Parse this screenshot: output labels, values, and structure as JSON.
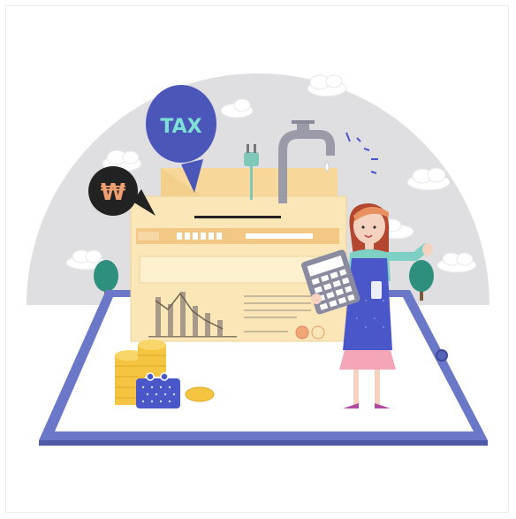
{
  "illustration": {
    "tax_bubble_text": "TAX",
    "currency_symbol": "₩"
  },
  "colors": {
    "dome": "#dfdfe2",
    "tablet_frame": "#6b78c8",
    "tablet_screen": "#ffffff",
    "document": "#fbe6b8",
    "document_dark": "#f2cf8a",
    "bubble_blue": "#4a57b8",
    "bubble_text": "#7fe0d6",
    "bubble_black": "#222222",
    "coin": "#f5c542",
    "apron": "#4a57c8",
    "skirt": "#f4a6b8",
    "hair": "#b3462e",
    "tree": "#2f8f7f"
  }
}
